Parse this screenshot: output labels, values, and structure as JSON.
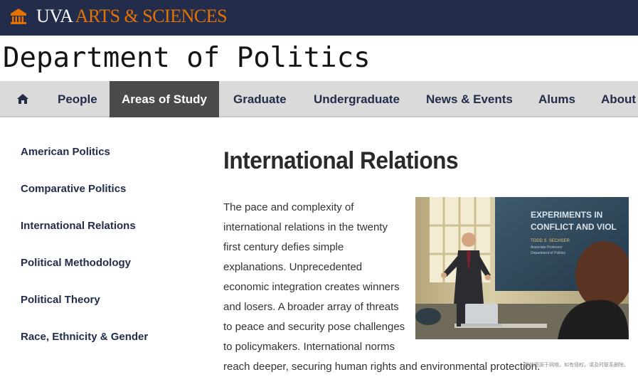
{
  "header": {
    "brand_uva": "UVA",
    "brand_arts": "ARTS & SCIENCES",
    "logo_icon": "rotunda-icon",
    "bar_color": "#232d4b",
    "accent_color": "#e57200"
  },
  "department": {
    "title": "Department of Politics"
  },
  "nav": {
    "home_icon": "home-icon",
    "items": [
      {
        "label": "People"
      },
      {
        "label": "Areas of Study"
      },
      {
        "label": "Graduate"
      },
      {
        "label": "Undergraduate"
      },
      {
        "label": "News & Events"
      },
      {
        "label": "Alums"
      },
      {
        "label": "About"
      }
    ],
    "active": "Areas of Study"
  },
  "sidebar": {
    "items": [
      {
        "label": "American Politics"
      },
      {
        "label": "Comparative Politics"
      },
      {
        "label": "International Relations"
      },
      {
        "label": "Political Methodology"
      },
      {
        "label": "Political Theory"
      },
      {
        "label": "Race, Ethnicity & Gender"
      }
    ]
  },
  "main": {
    "heading": "International Relations",
    "body_lines": [
      "The pace and complexity of",
      "international relations in the twenty",
      "first century defies simple",
      "explanations. Unprecedented",
      "economic integration creates winners",
      "and losers. A broader array of threats",
      "to peace and security pose challenges",
      "to policymakers. International norms",
      "reach deeper, securing human rights and environmental protection."
    ],
    "photo": {
      "screen_title_1": "EXPERIMENTS IN",
      "screen_title_2": "CONFLICT AND VIOL",
      "screen_name": "TODD S. SECHSER",
      "screen_role_1": "Associate Professor",
      "screen_role_2": "Department of Politics"
    }
  },
  "watermark": "微信图源于网络，如有侵权，请及时联系删除。"
}
